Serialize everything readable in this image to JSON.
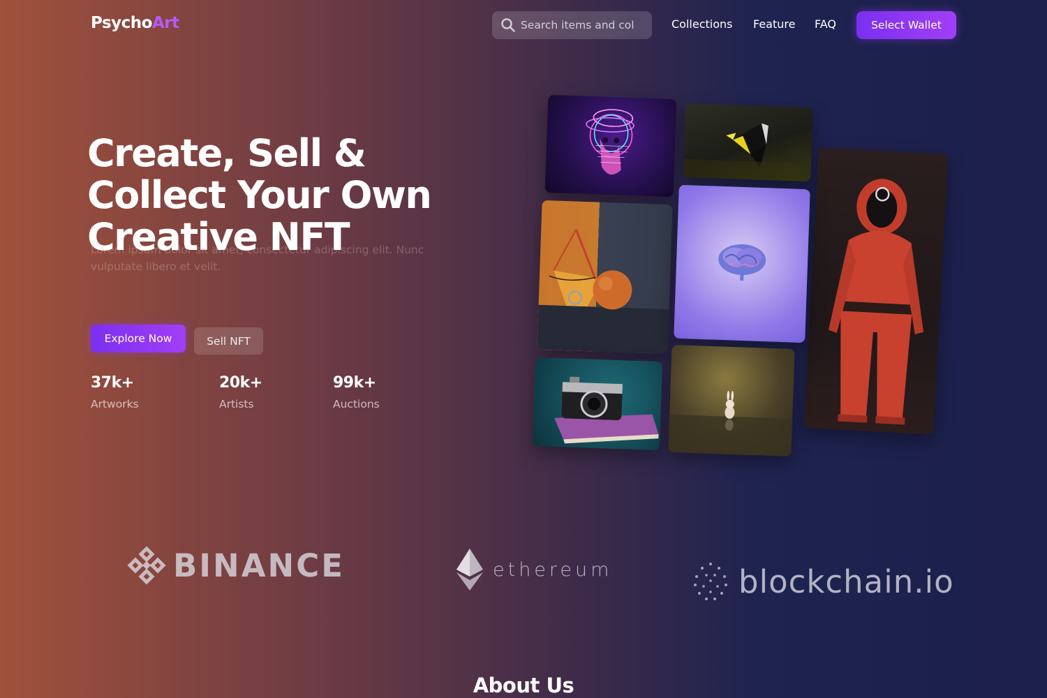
{
  "header": {
    "logo_main": "Psycho",
    "logo_accent": "Art",
    "search_placeholder": "Search items and col",
    "nav": [
      "Collections",
      "Feature",
      "FAQ"
    ],
    "wallet_button": "Select Wallet"
  },
  "hero": {
    "title_lines": [
      "Create, Sell &",
      "Collect Your Own",
      "Creative NFT"
    ],
    "faded_text_1": "Lorem ipsum dolor sit amet, consectetur adipiscing elit. Nunc",
    "faded_text_2": "vulputate libero et velit.",
    "explore_button": "Explore Now",
    "sell_button": "Sell NFT",
    "stats": [
      {
        "value": "37k+",
        "label": "Artworks"
      },
      {
        "value": "20k+",
        "label": "Artists"
      },
      {
        "value": "99k+",
        "label": "Auctions"
      }
    ]
  },
  "gallery": {
    "tiles": [
      "glitch-head-art",
      "abstract-geometry-art",
      "astronaut-figure-art",
      "shapes-still-life-art",
      "brain-art",
      "camera-on-book-art",
      "bunny-figure-art"
    ]
  },
  "partners": {
    "binance": "BINANCE",
    "ethereum": "ethereum",
    "blockchain": "blockchain.io"
  },
  "about": {
    "title": "About Us"
  },
  "colors": {
    "accent": "#8b35f2",
    "logo_accent": "#b55cf5",
    "gradient_left": "#a0513b",
    "gradient_right": "#1b1f4a"
  }
}
